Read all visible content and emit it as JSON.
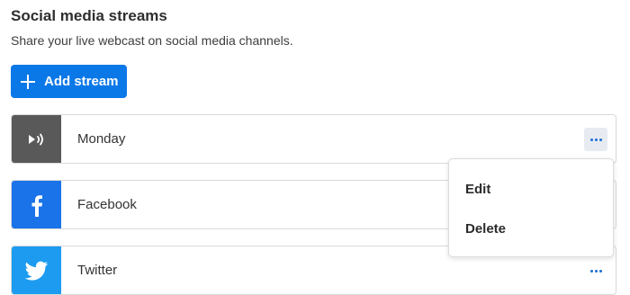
{
  "header": {
    "title": "Social media streams",
    "subtitle": "Share your live webcast on social media channels."
  },
  "add_button": {
    "label": "Add stream",
    "icon": "plus-icon",
    "color": "#0b78e8"
  },
  "streams": [
    {
      "label": "Monday",
      "icon": "broadcast-icon",
      "color": "#595959",
      "menu_open": true
    },
    {
      "label": "Facebook",
      "icon": "facebook-icon",
      "color": "#1a73e8"
    },
    {
      "label": "Twitter",
      "icon": "twitter-icon",
      "color": "#1d9bf0"
    }
  ],
  "context_menu": {
    "items": [
      {
        "label": "Edit"
      },
      {
        "label": "Delete"
      }
    ]
  }
}
